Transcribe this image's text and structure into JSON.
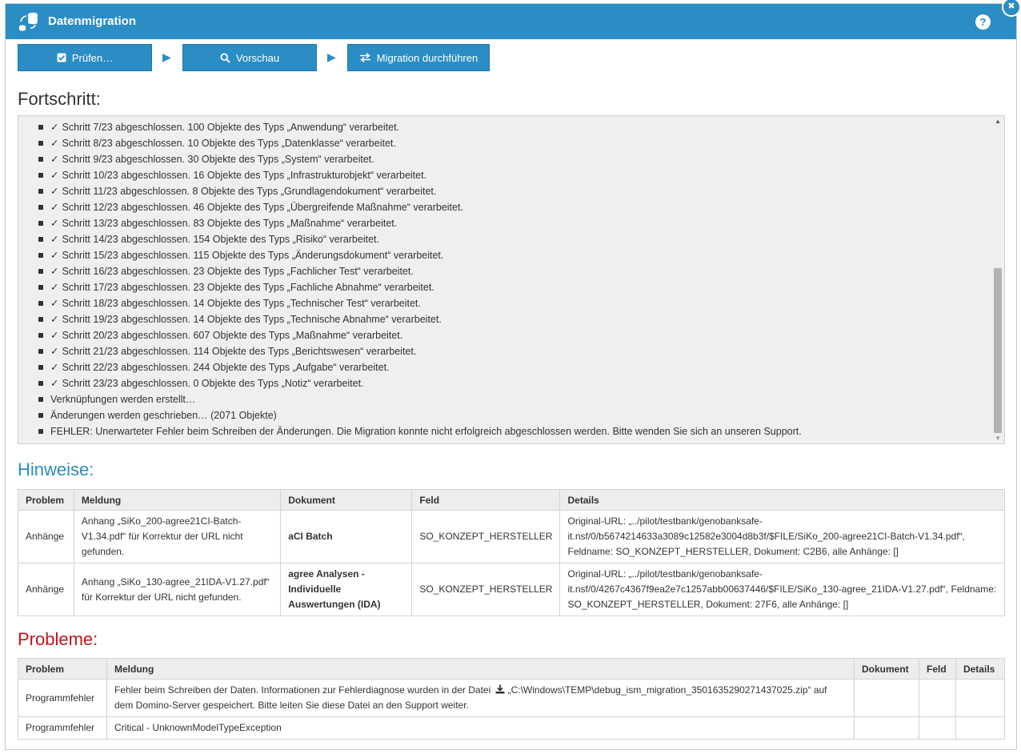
{
  "dialog": {
    "title": "Datenmigration",
    "help_label": "?",
    "close_label": "✖"
  },
  "toolbar": {
    "check_label": "Prüfen…",
    "preview_label": "Vorschau",
    "run_label": "Migration durchführen"
  },
  "progress": {
    "heading": "Fortschritt:",
    "items": [
      {
        "check": "✓",
        "text": "Schritt 7/23 abgeschlossen. 100 Objekte des Typs „Anwendung“ verarbeitet."
      },
      {
        "check": "✓",
        "text": "Schritt 8/23 abgeschlossen. 10 Objekte des Typs „Datenklasse“ verarbeitet."
      },
      {
        "check": "✓",
        "text": "Schritt 9/23 abgeschlossen. 30 Objekte des Typs „System“ verarbeitet."
      },
      {
        "check": "✓",
        "text": "Schritt 10/23 abgeschlossen. 16 Objekte des Typs „Infrastrukturobjekt“ verarbeitet."
      },
      {
        "check": "✓",
        "text": "Schritt 11/23 abgeschlossen. 8 Objekte des Typs „Grundlagendokument“ verarbeitet."
      },
      {
        "check": "✓",
        "text": "Schritt 12/23 abgeschlossen. 46 Objekte des Typs „Übergreifende Maßnahme“ verarbeitet."
      },
      {
        "check": "✓",
        "text": "Schritt 13/23 abgeschlossen. 83 Objekte des Typs „Maßnahme“ verarbeitet."
      },
      {
        "check": "✓",
        "text": "Schritt 14/23 abgeschlossen. 154 Objekte des Typs „Risiko“ verarbeitet."
      },
      {
        "check": "✓",
        "text": "Schritt 15/23 abgeschlossen. 115 Objekte des Typs „Änderungsdokument“ verarbeitet."
      },
      {
        "check": "✓",
        "text": "Schritt 16/23 abgeschlossen. 23 Objekte des Typs „Fachlicher Test“ verarbeitet."
      },
      {
        "check": "✓",
        "text": "Schritt 17/23 abgeschlossen. 23 Objekte des Typs „Fachliche Abnahme“ verarbeitet."
      },
      {
        "check": "✓",
        "text": "Schritt 18/23 abgeschlossen. 14 Objekte des Typs „Technischer Test“ verarbeitet."
      },
      {
        "check": "✓",
        "text": "Schritt 19/23 abgeschlossen. 14 Objekte des Typs „Technische Abnahme“ verarbeitet."
      },
      {
        "check": "✓",
        "text": "Schritt 20/23 abgeschlossen. 607 Objekte des Typs „Maßnahme“ verarbeitet."
      },
      {
        "check": "✓",
        "text": "Schritt 21/23 abgeschlossen. 114 Objekte des Typs „Berichtswesen“ verarbeitet."
      },
      {
        "check": "✓",
        "text": "Schritt 22/23 abgeschlossen. 244 Objekte des Typs „Aufgabe“ verarbeitet."
      },
      {
        "check": "✓",
        "text": "Schritt 23/23 abgeschlossen. 0 Objekte des Typs „Notiz“ verarbeitet."
      },
      {
        "check": "",
        "text": "Verknüpfungen werden erstellt…"
      },
      {
        "check": "",
        "text": "Änderungen werden geschrieben… (2071 Objekte)"
      },
      {
        "check": "",
        "text": "FEHLER: Unerwarteter Fehler beim Schreiben der Änderungen. Die Migration konnte nicht erfolgreich abgeschlossen werden. Bitte wenden Sie sich an unseren Support."
      }
    ]
  },
  "hints": {
    "heading": "Hinweise:",
    "columns": [
      "Problem",
      "Meldung",
      "Dokument",
      "Feld",
      "Details"
    ],
    "rows": [
      {
        "problem": "Anhänge",
        "message": "Anhang „SiKo_200-agree21CI-Batch-V1.34.pdf“ für Korrektur der URL nicht gefunden.",
        "document": "aCI Batch",
        "field": "SO_KONZEPT_HERSTELLER",
        "details": "Original-URL: „../pilot/testbank/genobanksafe-it.nsf/0/b5674214633a3089c12582e3004d8b3f/$FILE/SiKo_200-agree21CI-Batch-V1.34.pdf“, Feldname: SO_KONZEPT_HERSTELLER, Dokument: C2B6, alle Anhänge: []"
      },
      {
        "problem": "Anhänge",
        "message": "Anhang „SiKo_130-agree_21IDA-V1.27.pdf“ für Korrektur der URL nicht gefunden.",
        "document": "agree Analysen - Individuelle Auswertungen (IDA)",
        "field": "SO_KONZEPT_HERSTELLER",
        "details": "Original-URL: „../pilot/testbank/genobanksafe-it.nsf/0/4267c4367f9ea2e7c1257abb00637446/$FILE/SiKo_130-agree_21IDA-V1.27.pdf“, Feldname: SO_KONZEPT_HERSTELLER, Dokument: 27F6, alle Anhänge: []"
      }
    ]
  },
  "problems": {
    "heading": "Probleme:",
    "columns": [
      "Problem",
      "Meldung",
      "Dokument",
      "Feld",
      "Details"
    ],
    "rows": [
      {
        "problem": "Programmfehler",
        "message_before": "Fehler beim Schreiben der Daten. Informationen zur Fehlerdiagnose wurden in der Datei",
        "file_link": "„C:\\Windows\\TEMP\\debug_ism_migration_3501635290271437025.zip“",
        "message_after": "auf dem Domino-Server gespeichert. Bitte leiten Sie diese Datei an den Support weiter.",
        "document": "",
        "field": "",
        "details": ""
      },
      {
        "problem": "Programmfehler",
        "message": "Critical - UnknownModelTypeException",
        "document": "",
        "field": "",
        "details": ""
      }
    ]
  },
  "colors": {
    "accent": "#2a8dc4",
    "error": "#c0161b",
    "panel_bg": "#efefef"
  },
  "icons": {
    "title": "database-sync-icon",
    "help": "help-icon",
    "close": "close-icon",
    "check_button": "checkbox-icon",
    "preview_button": "search-icon",
    "run_button": "exchange-arrows-icon",
    "download": "download-icon"
  }
}
